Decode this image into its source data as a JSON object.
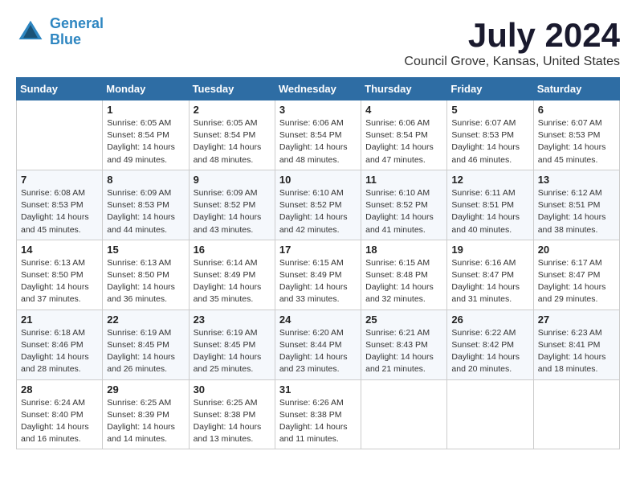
{
  "logo": {
    "line1": "General",
    "line2": "Blue"
  },
  "title": "July 2024",
  "subtitle": "Council Grove, Kansas, United States",
  "days_of_week": [
    "Sunday",
    "Monday",
    "Tuesday",
    "Wednesday",
    "Thursday",
    "Friday",
    "Saturday"
  ],
  "weeks": [
    [
      {
        "day": "",
        "text": ""
      },
      {
        "day": "1",
        "text": "Sunrise: 6:05 AM\nSunset: 8:54 PM\nDaylight: 14 hours\nand 49 minutes."
      },
      {
        "day": "2",
        "text": "Sunrise: 6:05 AM\nSunset: 8:54 PM\nDaylight: 14 hours\nand 48 minutes."
      },
      {
        "day": "3",
        "text": "Sunrise: 6:06 AM\nSunset: 8:54 PM\nDaylight: 14 hours\nand 48 minutes."
      },
      {
        "day": "4",
        "text": "Sunrise: 6:06 AM\nSunset: 8:54 PM\nDaylight: 14 hours\nand 47 minutes."
      },
      {
        "day": "5",
        "text": "Sunrise: 6:07 AM\nSunset: 8:53 PM\nDaylight: 14 hours\nand 46 minutes."
      },
      {
        "day": "6",
        "text": "Sunrise: 6:07 AM\nSunset: 8:53 PM\nDaylight: 14 hours\nand 45 minutes."
      }
    ],
    [
      {
        "day": "7",
        "text": "Sunrise: 6:08 AM\nSunset: 8:53 PM\nDaylight: 14 hours\nand 45 minutes."
      },
      {
        "day": "8",
        "text": "Sunrise: 6:09 AM\nSunset: 8:53 PM\nDaylight: 14 hours\nand 44 minutes."
      },
      {
        "day": "9",
        "text": "Sunrise: 6:09 AM\nSunset: 8:52 PM\nDaylight: 14 hours\nand 43 minutes."
      },
      {
        "day": "10",
        "text": "Sunrise: 6:10 AM\nSunset: 8:52 PM\nDaylight: 14 hours\nand 42 minutes."
      },
      {
        "day": "11",
        "text": "Sunrise: 6:10 AM\nSunset: 8:52 PM\nDaylight: 14 hours\nand 41 minutes."
      },
      {
        "day": "12",
        "text": "Sunrise: 6:11 AM\nSunset: 8:51 PM\nDaylight: 14 hours\nand 40 minutes."
      },
      {
        "day": "13",
        "text": "Sunrise: 6:12 AM\nSunset: 8:51 PM\nDaylight: 14 hours\nand 38 minutes."
      }
    ],
    [
      {
        "day": "14",
        "text": "Sunrise: 6:13 AM\nSunset: 8:50 PM\nDaylight: 14 hours\nand 37 minutes."
      },
      {
        "day": "15",
        "text": "Sunrise: 6:13 AM\nSunset: 8:50 PM\nDaylight: 14 hours\nand 36 minutes."
      },
      {
        "day": "16",
        "text": "Sunrise: 6:14 AM\nSunset: 8:49 PM\nDaylight: 14 hours\nand 35 minutes."
      },
      {
        "day": "17",
        "text": "Sunrise: 6:15 AM\nSunset: 8:49 PM\nDaylight: 14 hours\nand 33 minutes."
      },
      {
        "day": "18",
        "text": "Sunrise: 6:15 AM\nSunset: 8:48 PM\nDaylight: 14 hours\nand 32 minutes."
      },
      {
        "day": "19",
        "text": "Sunrise: 6:16 AM\nSunset: 8:47 PM\nDaylight: 14 hours\nand 31 minutes."
      },
      {
        "day": "20",
        "text": "Sunrise: 6:17 AM\nSunset: 8:47 PM\nDaylight: 14 hours\nand 29 minutes."
      }
    ],
    [
      {
        "day": "21",
        "text": "Sunrise: 6:18 AM\nSunset: 8:46 PM\nDaylight: 14 hours\nand 28 minutes."
      },
      {
        "day": "22",
        "text": "Sunrise: 6:19 AM\nSunset: 8:45 PM\nDaylight: 14 hours\nand 26 minutes."
      },
      {
        "day": "23",
        "text": "Sunrise: 6:19 AM\nSunset: 8:45 PM\nDaylight: 14 hours\nand 25 minutes."
      },
      {
        "day": "24",
        "text": "Sunrise: 6:20 AM\nSunset: 8:44 PM\nDaylight: 14 hours\nand 23 minutes."
      },
      {
        "day": "25",
        "text": "Sunrise: 6:21 AM\nSunset: 8:43 PM\nDaylight: 14 hours\nand 21 minutes."
      },
      {
        "day": "26",
        "text": "Sunrise: 6:22 AM\nSunset: 8:42 PM\nDaylight: 14 hours\nand 20 minutes."
      },
      {
        "day": "27",
        "text": "Sunrise: 6:23 AM\nSunset: 8:41 PM\nDaylight: 14 hours\nand 18 minutes."
      }
    ],
    [
      {
        "day": "28",
        "text": "Sunrise: 6:24 AM\nSunset: 8:40 PM\nDaylight: 14 hours\nand 16 minutes."
      },
      {
        "day": "29",
        "text": "Sunrise: 6:25 AM\nSunset: 8:39 PM\nDaylight: 14 hours\nand 14 minutes."
      },
      {
        "day": "30",
        "text": "Sunrise: 6:25 AM\nSunset: 8:38 PM\nDaylight: 14 hours\nand 13 minutes."
      },
      {
        "day": "31",
        "text": "Sunrise: 6:26 AM\nSunset: 8:38 PM\nDaylight: 14 hours\nand 11 minutes."
      },
      {
        "day": "",
        "text": ""
      },
      {
        "day": "",
        "text": ""
      },
      {
        "day": "",
        "text": ""
      }
    ]
  ]
}
